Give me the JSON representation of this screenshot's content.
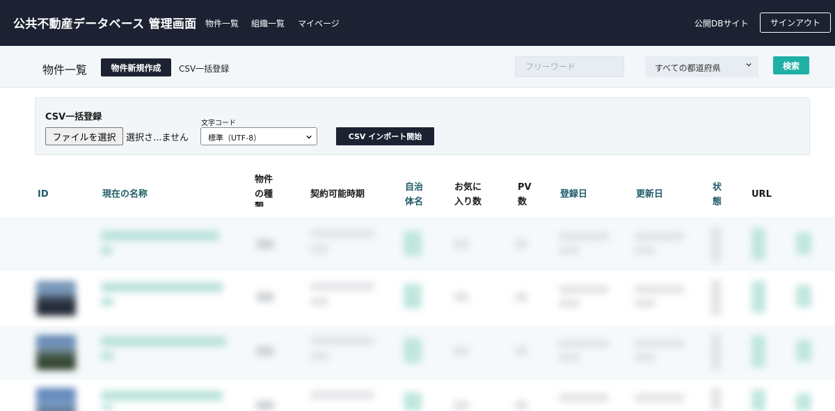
{
  "header": {
    "brand": "公共不動産データベース 管理画面",
    "nav": [
      "物件一覧",
      "組織一覧",
      "マイページ"
    ],
    "public_site": "公開DBサイト",
    "signout": "サインアウト"
  },
  "subheader": {
    "title": "物件一覧",
    "new_button": "物件新規作成",
    "csv_link": "CSV一括登録",
    "search_placeholder": "フリーワード",
    "prefecture_selected": "すべての都道府県",
    "search_button": "検索"
  },
  "csv_panel": {
    "title": "CSV一括登録",
    "file_button": "ファイルを選択",
    "file_status": "選択さ...ません",
    "encoding_label": "文字コード",
    "encoding_selected": "標準（UTF-8）",
    "import_button": "CSV インポート開始"
  },
  "table": {
    "columns": {
      "id": "ID",
      "name": "現在の名称",
      "type_1": "物件",
      "type_2": "の種",
      "type_3": "類",
      "period": "契約可能時期",
      "muni_1": "自治",
      "muni_2": "体名",
      "fav_1": "お気に",
      "fav_2": "入り数",
      "pv_1": "PV",
      "pv_2": "数",
      "created": "登録日",
      "updated": "更新日",
      "status_1": "状",
      "status_2": "態",
      "url": "URL"
    }
  },
  "colors": {
    "navbar": "#1c2232",
    "accent_teal": "#1fb0a5",
    "header_link": "#1e5b67"
  }
}
